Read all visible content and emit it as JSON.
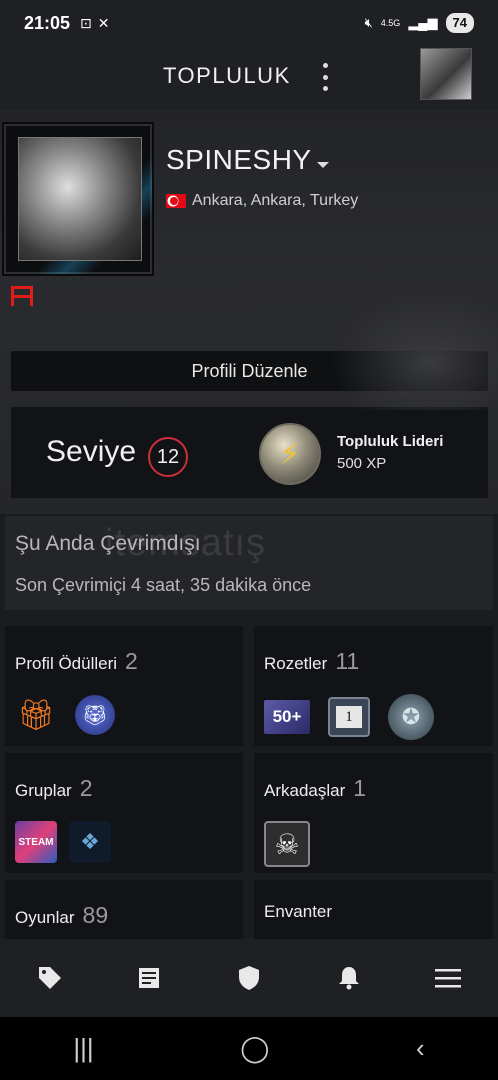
{
  "status_bar": {
    "time": "21:05",
    "network": "4.5G",
    "battery": "74"
  },
  "header": {
    "title": "TOPLULUK"
  },
  "profile": {
    "username": "SPINESHY",
    "location": "Ankara, Ankara, Turkey",
    "edit_button": "Profili Düzenle",
    "level_label": "Seviye",
    "level_value": "12",
    "badge_title": "Topluluk Lideri",
    "badge_xp": "500 XP"
  },
  "online": {
    "status": "Şu Anda Çevrimdışı",
    "last_online": "Son Çevrimiçi 4 saat, 35 dakika önce",
    "watermark": "itemsatış"
  },
  "tiles": {
    "profile_rewards": {
      "label": "Profil Ödülleri",
      "count": "2"
    },
    "badges": {
      "label": "Rozetler",
      "count": "11",
      "badge_50": "50+",
      "badge_1": "1"
    },
    "groups": {
      "label": "Gruplar",
      "count": "2",
      "group_1_text": "STEAM"
    },
    "friends": {
      "label": "Arkadaşlar",
      "count": "1"
    },
    "games": {
      "label": "Oyunlar",
      "count": "89"
    },
    "inventory": {
      "label": "Envanter"
    }
  },
  "colors": {
    "level_ring": "#c9313a",
    "flag_red": "#e30a17",
    "background": "#1b1c1f"
  }
}
